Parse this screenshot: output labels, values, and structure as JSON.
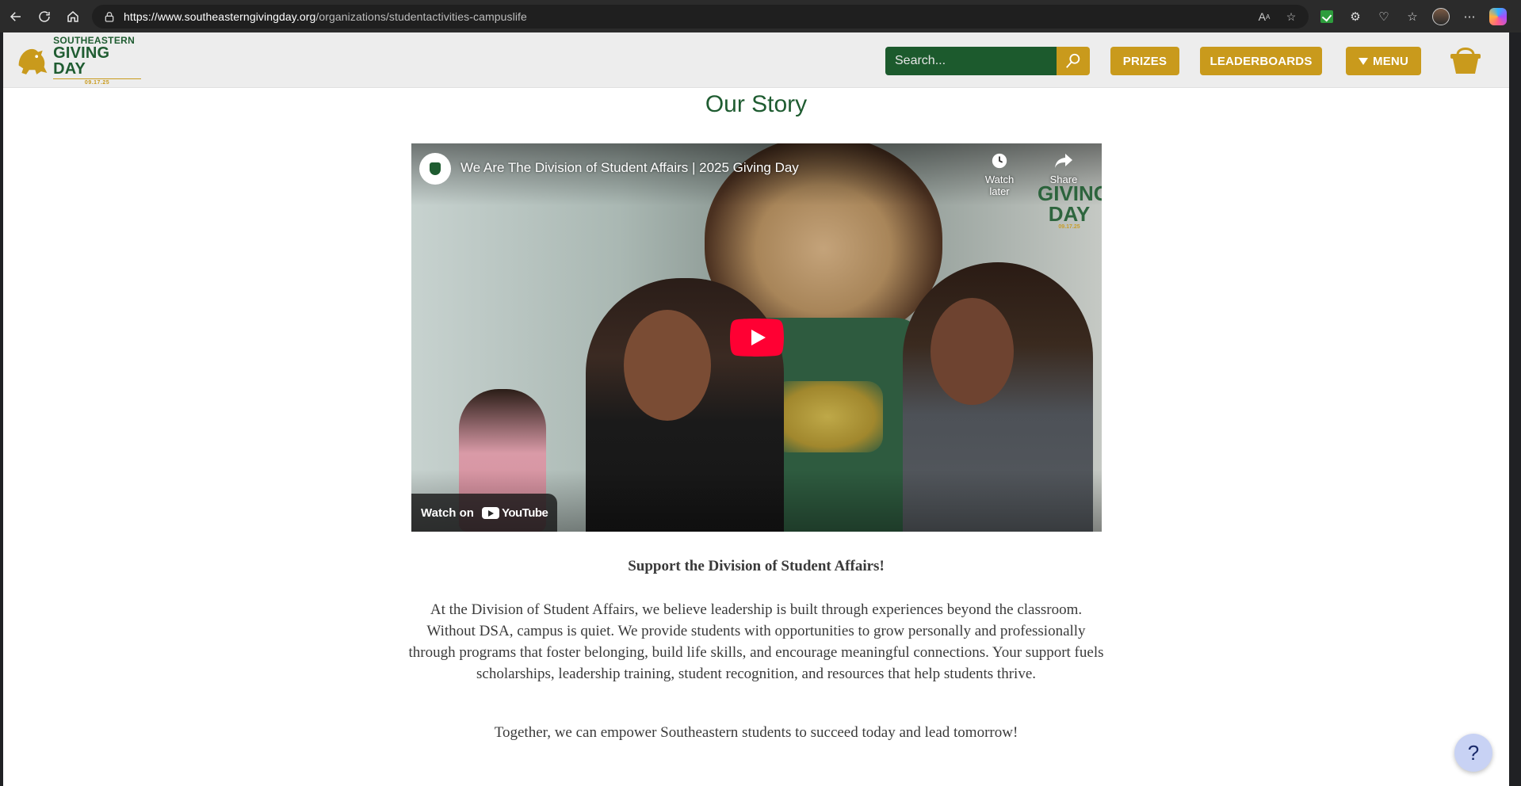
{
  "browser": {
    "url_host": "https://www.southeasterngivingday.org",
    "url_path": "/organizations/studentactivities-campuslife"
  },
  "site": {
    "logo": {
      "line1": "SOUTHEASTERN",
      "line2": "GIVING DAY",
      "line3": "09.17.25"
    },
    "search_placeholder": "Search...",
    "prizes_label": "PRIZES",
    "leaderboards_label": "LEADERBOARDS",
    "menu_label": "MENU",
    "colors": {
      "green": "#1f5c31",
      "gold": "#c99a1c"
    }
  },
  "story": {
    "title": "Our Story",
    "video": {
      "title": "We Are The Division of Student Affairs | 2025 Giving Day",
      "watch_later": "Watch later",
      "share": "Share",
      "watch_on": "Watch on",
      "youtube": "YouTube",
      "overlay_logo_line1": "GIVING",
      "overlay_logo_line2": "DAY",
      "overlay_logo_date": "09.17.25"
    },
    "heading": "Support the Division of Student Affairs!",
    "body": "At the Division of Student Affairs, we believe leadership is built through experiences beyond the classroom. Without DSA, campus is quiet. We provide students with opportunities to grow personally and professionally through programs that foster belonging, build life skills, and encourage meaningful connections. Your support fuels scholarships, leadership training, student recognition, and resources that help students thrive.",
    "closing": "Together, we can empower Southeastern students to succeed today and lead tomorrow!"
  },
  "help": {
    "label": "?"
  }
}
